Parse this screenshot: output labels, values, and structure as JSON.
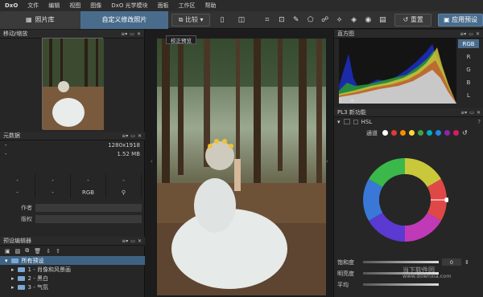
{
  "menu": {
    "logo": "DxO",
    "items": [
      "文件",
      "编辑",
      "视图",
      "图像",
      "DxO 光学模块",
      "面板",
      "工作区",
      "帮助"
    ]
  },
  "toolbar": {
    "tab_library": "照片库",
    "tab_customize": "自定义修改照片",
    "compare": "比较",
    "reset": "重置",
    "apply_preset": "应用预设"
  },
  "tooltip": "校正预览",
  "left": {
    "nav_title": "移动/缩放",
    "meta_title": "元数据",
    "meta_dimensions": "1280x1918",
    "meta_size": "1.52 MB",
    "meta_dash": "-",
    "meta_color": "RGB",
    "author_label": "作者",
    "copyright_label": "版权",
    "preset_title": "预设编辑器",
    "presets": [
      "所有预设",
      "1 - 肖像和风景画",
      "2 - 黑白",
      "3 - 气氛"
    ]
  },
  "right": {
    "hist_title": "直方图",
    "channels": [
      "RGB",
      "R",
      "G",
      "B",
      "L"
    ],
    "pl3_title": "PL3 新功能",
    "hsl_label": "HSL",
    "channel_label": "通道",
    "help_mark": "?",
    "saturation_label": "饱和度",
    "saturation_value": "0",
    "lightness_label": "明亮度",
    "uniform_label": "平均"
  },
  "colors": {
    "accent": "#4a6c8c",
    "swatches": [
      "#ffffff",
      "#e53935",
      "#fb8c00",
      "#fdd835",
      "#43a047",
      "#00acc1",
      "#1e88e5",
      "#8e24aa",
      "#d81b60"
    ]
  },
  "watermark": {
    "line1": "当下软件园",
    "line2": "www.downxia.com"
  }
}
